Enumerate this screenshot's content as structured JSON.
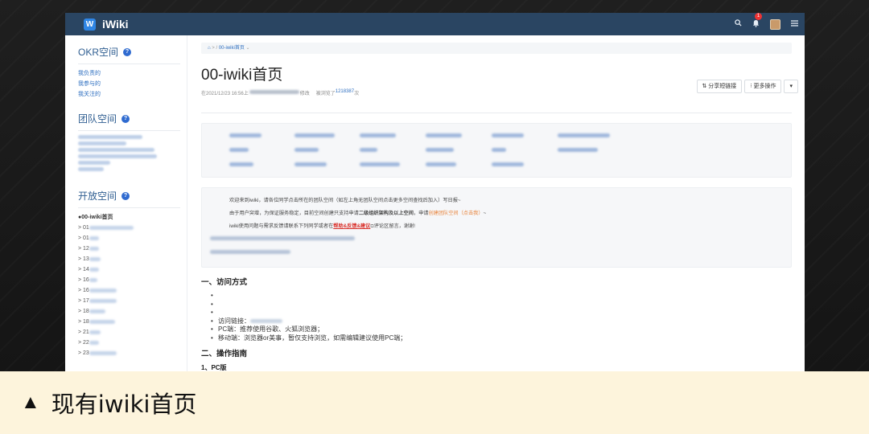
{
  "app": {
    "name": "iWiki",
    "logo_letter": "W",
    "notification_count": "1"
  },
  "icons": {
    "search": "search-icon",
    "bell": "bell-icon",
    "avatar": "avatar-icon",
    "menu": "menu-icon",
    "home": "home-icon"
  },
  "sidebar": {
    "okr": {
      "title": "OKR空间",
      "links": [
        "我负责的",
        "我参与的",
        "我关注的"
      ]
    },
    "team": {
      "title": "团队空间"
    },
    "open": {
      "title": "开放空间",
      "current": "●00-iwiki首页"
    },
    "tree_prefixes": [
      "> 01",
      "> 01",
      "> 12",
      "> 13",
      "> 14",
      "> 16",
      "> 16",
      "> 17",
      "> 18",
      "> 18",
      "> 21",
      "> 22",
      "> 23"
    ]
  },
  "breadcrumb": {
    "home": "⌂",
    "sep": "> /",
    "current": "00-iwiki首页",
    "chevron": "⌄"
  },
  "page": {
    "title": "00-iwiki首页",
    "meta_prefix": "在2021/12/23 16:56上",
    "meta_suffix": "修改",
    "views_prefix": "被浏览了",
    "views_count": "1218387",
    "views_suffix": "次"
  },
  "actions": {
    "share": "⇅ 分享短链接",
    "more": "⁝ 更多操作",
    "dropdown": "▾"
  },
  "notice": {
    "line1": "欢迎来到iwiki，请各位同学点击所在的团队空间（如左上角无团队空间点击更多空间查找后加入）写日报~",
    "line2a": "由于用户突增，为保证服务稳定，目前空间创建只支持申请",
    "line2b": "二级组织架构及以上空间",
    "line2c": "，申请",
    "line2d": "创建团队空间（点击我）",
    "line2e": "~",
    "line3a": "iwiki使用问题与需求反馈请联系下列同学或者在",
    "line3b": "帮助&反馈&建议",
    "line3c": "评论区留言，谢谢!"
  },
  "content": {
    "h1": "一、访问方式",
    "bullets": [
      "访问链接：",
      "PC端：推荐使用谷歌、火狐浏览器；",
      "移动端：浏览器or美事，暂仅支持浏览，如需编辑建议使用PC端；"
    ],
    "h2": "二、操作指南",
    "sub": "1、PC版"
  },
  "caption": {
    "marker": "▲",
    "text": "现有iwiki首页"
  }
}
